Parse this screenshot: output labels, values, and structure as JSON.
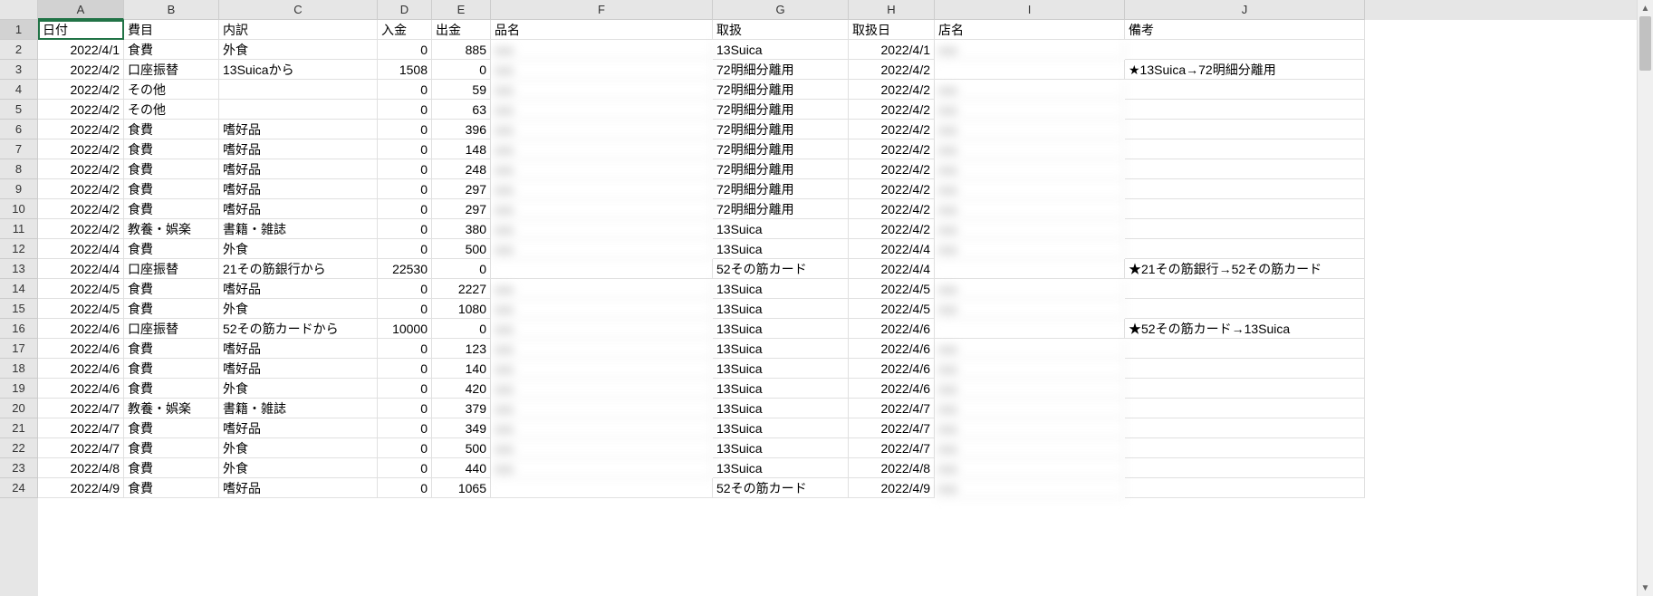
{
  "columns": [
    {
      "letter": "A",
      "width": "col-A"
    },
    {
      "letter": "B",
      "width": "col-B"
    },
    {
      "letter": "C",
      "width": "col-C"
    },
    {
      "letter": "D",
      "width": "col-D"
    },
    {
      "letter": "E",
      "width": "col-E"
    },
    {
      "letter": "F",
      "width": "col-F"
    },
    {
      "letter": "G",
      "width": "col-G"
    },
    {
      "letter": "H",
      "width": "col-H"
    },
    {
      "letter": "I",
      "width": "col-I"
    },
    {
      "letter": "J",
      "width": "col-J"
    }
  ],
  "headers": {
    "A": "日付",
    "B": "費目",
    "C": "内訳",
    "D": "入金",
    "E": "出金",
    "F": "品名",
    "G": "取扱",
    "H": "取扱日",
    "I": "店名",
    "J": "備考"
  },
  "rows": [
    {
      "n": 1,
      "A": "日付",
      "B": "費目",
      "C": "内訳",
      "D": "入金",
      "E": "出金",
      "F": "品名",
      "G": "取扱",
      "H": "取扱日",
      "I": "店名",
      "J": "備考",
      "isHeader": true
    },
    {
      "n": 2,
      "A": "2022/4/1",
      "B": "食費",
      "C": "外食",
      "D": "0",
      "E": "885",
      "F": "xxx",
      "G": "13Suica",
      "H": "2022/4/1",
      "I": "xxx",
      "J": ""
    },
    {
      "n": 3,
      "A": "2022/4/2",
      "B": "口座振替",
      "C": "13Suicaから",
      "D": "1508",
      "E": "0",
      "F": "xxx",
      "G": "72明細分離用",
      "H": "2022/4/2",
      "I": "",
      "J": "★13Suica→72明細分離用"
    },
    {
      "n": 4,
      "A": "2022/4/2",
      "B": "その他",
      "C": "",
      "D": "0",
      "E": "59",
      "F": "xxx",
      "G": "72明細分離用",
      "H": "2022/4/2",
      "I": "xxx",
      "J": ""
    },
    {
      "n": 5,
      "A": "2022/4/2",
      "B": "その他",
      "C": "",
      "D": "0",
      "E": "63",
      "F": "xxx",
      "G": "72明細分離用",
      "H": "2022/4/2",
      "I": "xxx",
      "J": ""
    },
    {
      "n": 6,
      "A": "2022/4/2",
      "B": "食費",
      "C": "嗜好品",
      "D": "0",
      "E": "396",
      "F": "xxx",
      "G": "72明細分離用",
      "H": "2022/4/2",
      "I": "xxx",
      "J": ""
    },
    {
      "n": 7,
      "A": "2022/4/2",
      "B": "食費",
      "C": "嗜好品",
      "D": "0",
      "E": "148",
      "F": "xxx",
      "G": "72明細分離用",
      "H": "2022/4/2",
      "I": "xxx",
      "J": ""
    },
    {
      "n": 8,
      "A": "2022/4/2",
      "B": "食費",
      "C": "嗜好品",
      "D": "0",
      "E": "248",
      "F": "xxx",
      "G": "72明細分離用",
      "H": "2022/4/2",
      "I": "xxx",
      "J": ""
    },
    {
      "n": 9,
      "A": "2022/4/2",
      "B": "食費",
      "C": "嗜好品",
      "D": "0",
      "E": "297",
      "F": "xxx",
      "G": "72明細分離用",
      "H": "2022/4/2",
      "I": "xxx",
      "J": ""
    },
    {
      "n": 10,
      "A": "2022/4/2",
      "B": "食費",
      "C": "嗜好品",
      "D": "0",
      "E": "297",
      "F": "xxx",
      "G": "72明細分離用",
      "H": "2022/4/2",
      "I": "xxx",
      "J": ""
    },
    {
      "n": 11,
      "A": "2022/4/2",
      "B": "教養・娯楽",
      "C": "書籍・雑誌",
      "D": "0",
      "E": "380",
      "F": "xxx",
      "G": "13Suica",
      "H": "2022/4/2",
      "I": "xxx",
      "J": ""
    },
    {
      "n": 12,
      "A": "2022/4/4",
      "B": "食費",
      "C": "外食",
      "D": "0",
      "E": "500",
      "F": "xxx",
      "G": "13Suica",
      "H": "2022/4/4",
      "I": "xxx",
      "J": ""
    },
    {
      "n": 13,
      "A": "2022/4/4",
      "B": "口座振替",
      "C": "21その筋銀行から",
      "D": "22530",
      "E": "0",
      "F": "",
      "G": "52その筋カード",
      "H": "2022/4/4",
      "I": "",
      "J": "★21その筋銀行→52その筋カード"
    },
    {
      "n": 14,
      "A": "2022/4/5",
      "B": "食費",
      "C": "嗜好品",
      "D": "0",
      "E": "2227",
      "F": "xxx",
      "G": "13Suica",
      "H": "2022/4/5",
      "I": "xxx",
      "J": ""
    },
    {
      "n": 15,
      "A": "2022/4/5",
      "B": "食費",
      "C": "外食",
      "D": "0",
      "E": "1080",
      "F": "xxx",
      "G": "13Suica",
      "H": "2022/4/5",
      "I": "xxx",
      "J": ""
    },
    {
      "n": 16,
      "A": "2022/4/6",
      "B": "口座振替",
      "C": "52その筋カードから",
      "D": "10000",
      "E": "0",
      "F": "xxx",
      "G": "13Suica",
      "H": "2022/4/6",
      "I": "",
      "J": "★52その筋カード→13Suica"
    },
    {
      "n": 17,
      "A": "2022/4/6",
      "B": "食費",
      "C": "嗜好品",
      "D": "0",
      "E": "123",
      "F": "xxx",
      "G": "13Suica",
      "H": "2022/4/6",
      "I": "xxx",
      "J": ""
    },
    {
      "n": 18,
      "A": "2022/4/6",
      "B": "食費",
      "C": "嗜好品",
      "D": "0",
      "E": "140",
      "F": "xxx",
      "G": "13Suica",
      "H": "2022/4/6",
      "I": "xxx",
      "J": ""
    },
    {
      "n": 19,
      "A": "2022/4/6",
      "B": "食費",
      "C": "外食",
      "D": "0",
      "E": "420",
      "F": "xxx",
      "G": "13Suica",
      "H": "2022/4/6",
      "I": "xxx",
      "J": ""
    },
    {
      "n": 20,
      "A": "2022/4/7",
      "B": "教養・娯楽",
      "C": "書籍・雑誌",
      "D": "0",
      "E": "379",
      "F": "xxx",
      "G": "13Suica",
      "H": "2022/4/7",
      "I": "xxx",
      "J": ""
    },
    {
      "n": 21,
      "A": "2022/4/7",
      "B": "食費",
      "C": "嗜好品",
      "D": "0",
      "E": "349",
      "F": "xxx",
      "G": "13Suica",
      "H": "2022/4/7",
      "I": "xxx",
      "J": ""
    },
    {
      "n": 22,
      "A": "2022/4/7",
      "B": "食費",
      "C": "外食",
      "D": "0",
      "E": "500",
      "F": "xxx",
      "G": "13Suica",
      "H": "2022/4/7",
      "I": "xxx",
      "J": ""
    },
    {
      "n": 23,
      "A": "2022/4/8",
      "B": "食費",
      "C": "外食",
      "D": "0",
      "E": "440",
      "F": "xxx",
      "G": "13Suica",
      "H": "2022/4/8",
      "I": "xxx",
      "J": ""
    },
    {
      "n": 24,
      "A": "2022/4/9",
      "B": "食費",
      "C": "嗜好品",
      "D": "0",
      "E": "1065",
      "F": "",
      "G": "52その筋カード",
      "H": "2022/4/9",
      "I": "xxx",
      "J": ""
    }
  ],
  "selectedCell": "A1",
  "alignRight": [
    "A",
    "D",
    "E",
    "H"
  ],
  "blurredCols": [
    "F",
    "I"
  ]
}
